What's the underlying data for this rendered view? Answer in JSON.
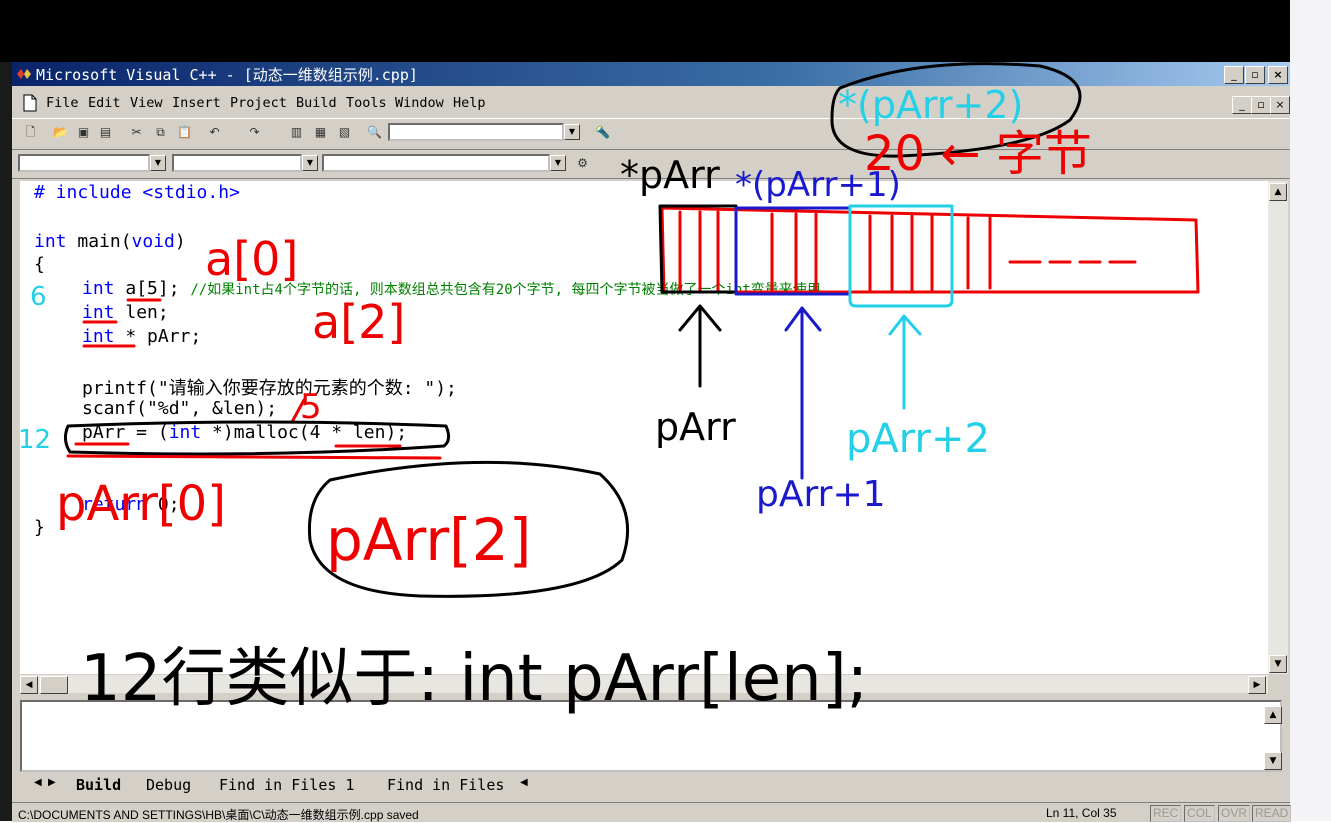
{
  "window": {
    "title": "Microsoft Visual C++ - [动态一维数组示例.cpp]",
    "minimize": "_",
    "maximize": "▫",
    "close": "×"
  },
  "menu": {
    "file": "File",
    "edit": "Edit",
    "view": "View",
    "insert": "Insert",
    "project": "Project",
    "build": "Build",
    "tools": "Tools",
    "window": "Window",
    "help": "Help"
  },
  "code": {
    "line1": "# include <stdio.h>",
    "line3_kw": "int",
    "line3_rest": " main(",
    "line3_kw2": "void",
    "line3_end": ")",
    "line4": "{",
    "line5_kw": "int",
    "line5_rest": " a[5]; ",
    "line5_comment": "//如果int占4个字节的话, 则本数组总共包含有20个字节, 每四个字节被当做了一个int变量来使用",
    "line6_kw": "int",
    "line6_rest": " len;",
    "line7_kw": "int",
    "line7_rest": " * pArr;",
    "line9": "printf(\"请输入你要存放的元素的个数: \");",
    "line10": "scanf(\"%d\", &len);",
    "line11_pre": "pArr = (",
    "line11_kw": "int",
    "line11_rest": " *)malloc(4 * len);",
    "line13_kw": "return",
    "line13_rest": " 0;",
    "line14": "}"
  },
  "tabs": {
    "build": "Build",
    "debug": "Debug",
    "find1": "Find in Files 1",
    "find2": "Find in Files"
  },
  "status": {
    "message": "C:\\DOCUMENTS AND SETTINGS\\HB\\桌面\\C\\动态一维数组示例.cpp saved",
    "position": "Ln 11, Col 35",
    "rec": "REC",
    "col": "COL",
    "ovr": "OVR",
    "read": "READ"
  },
  "colors": {
    "ink_black": "#000000",
    "ink_red": "#ee0000",
    "ink_blue": "#1a1acc",
    "ink_cyan": "#22d0e8",
    "keyword": "#0000ff",
    "comment": "#008000"
  }
}
